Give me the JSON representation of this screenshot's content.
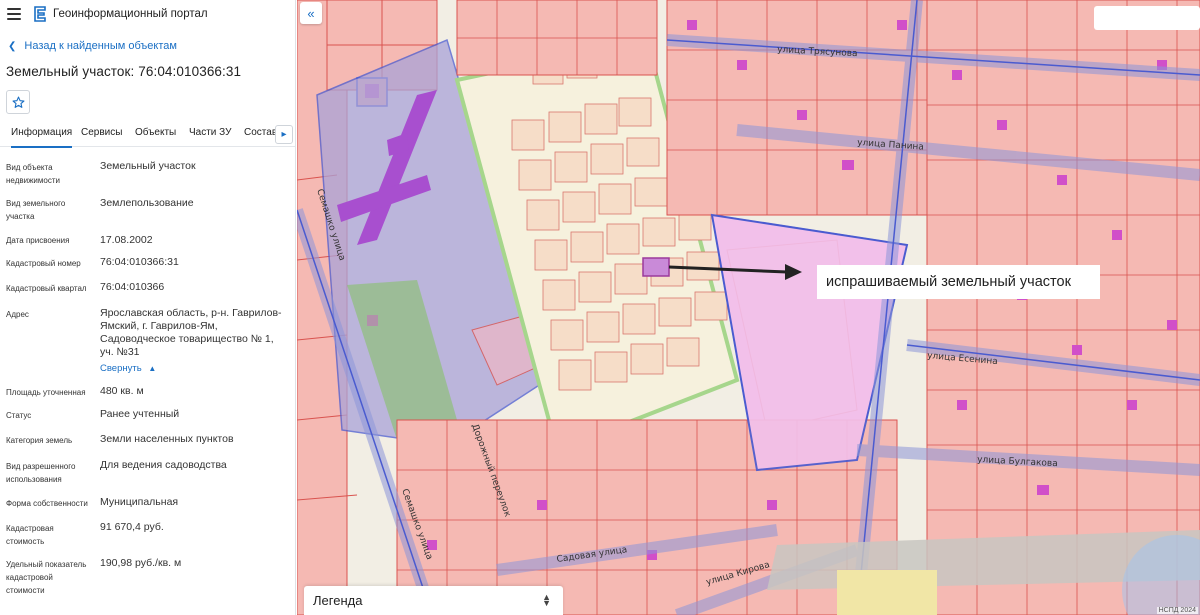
{
  "header": {
    "app_title": "Геоинформационный портал",
    "menu_icon": "hamburger-menu-icon",
    "logo_icon": "portal-logo-icon"
  },
  "sidebar": {
    "back_link": "Назад к найденным объектам",
    "title": "Земельный участок: 76:04:010366:31",
    "favorite_icon": "star-icon",
    "tabs": [
      "Информация",
      "Сервисы",
      "Объекты",
      "Части ЗУ",
      "Состав"
    ],
    "active_tab": "Информация",
    "properties": [
      {
        "label": "Вид объекта недвижимости",
        "value": "Земельный участок"
      },
      {
        "label": "Вид земельного участка",
        "value": "Землепользование"
      },
      {
        "label": "Дата присвоения",
        "value": "17.08.2002"
      },
      {
        "label": "Кадастровый номер",
        "value": "76:04:010366:31"
      },
      {
        "label": "Кадастровый квартал",
        "value": "76:04:010366"
      },
      {
        "label": "Адрес",
        "value": "Ярославская область, р-н. Гаврилов-Ямский, г. Гаврилов-Ям, Садоводческое товарищество № 1, уч. №31"
      },
      {
        "label": "Площадь уточненная",
        "value": "480 кв. м"
      },
      {
        "label": "Статус",
        "value": "Ранее учтенный"
      },
      {
        "label": "Категория земель",
        "value": "Земли населенных пунктов"
      },
      {
        "label": "Вид разрешенного использования",
        "value": "Для ведения садоводства"
      },
      {
        "label": "Форма собственности",
        "value": "Муниципальная"
      },
      {
        "label": "Кадастровая стоимость",
        "value": "91 670,4 руб."
      },
      {
        "label": "Удельный показатель кадастровой стоимости",
        "value": "190,98 руб./кв. м"
      }
    ],
    "collapse_label": "Свернуть"
  },
  "map": {
    "annotation": "испрашиваемый земельный участок",
    "legend_label": "Легенда",
    "copyright": "НСПД 2024",
    "streets": {
      "tryasunova": "улица Трясунова",
      "panina": "улица Панина",
      "esenina": "улица Есенина",
      "bulgakova": "улица Булгакова",
      "sadovaya": "Садовая улица",
      "kirova": "улица Кирова",
      "dorozhny": "Дорожный переулок",
      "semashko1": "Семашко улица",
      "semashko2": "Семашко улица"
    },
    "colors": {
      "parcel_fill": "#f5b9b3",
      "parcel_stroke": "#d9534f",
      "quarter_stroke": "#4a5bd0",
      "building": "#d14fc9",
      "highlight_zone": "#f2c0ea",
      "garden_zone": "#f6f1dd",
      "green": "#a6d68c"
    }
  }
}
